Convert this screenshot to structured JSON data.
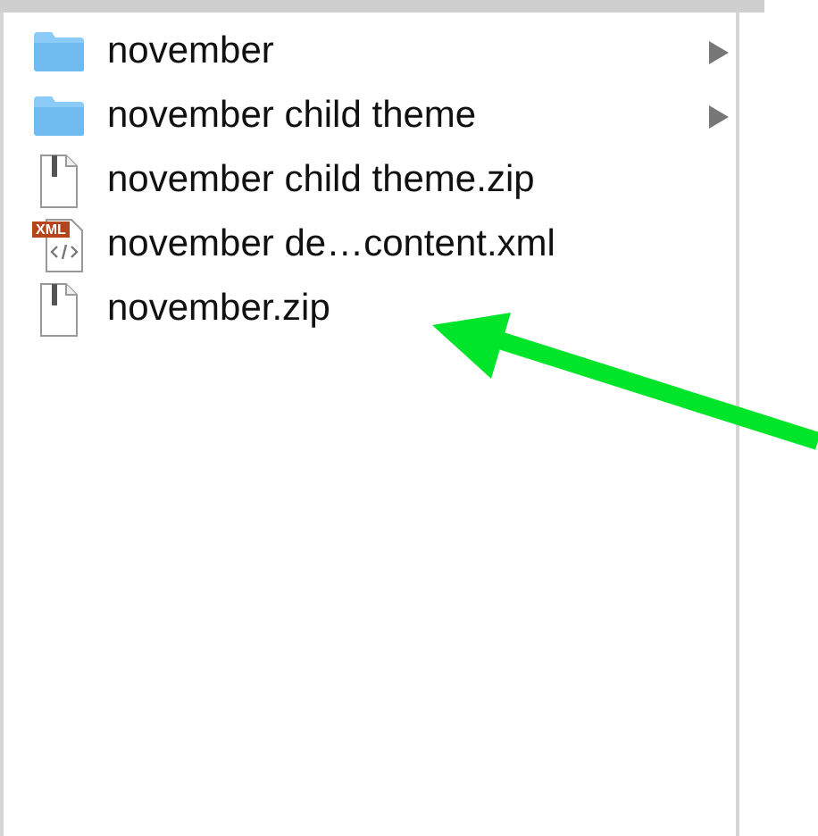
{
  "items": [
    {
      "name": "november",
      "kind": "folder",
      "expandable": true
    },
    {
      "name": "november child theme",
      "kind": "folder",
      "expandable": true
    },
    {
      "name": "november child theme.zip",
      "kind": "zip",
      "expandable": false
    },
    {
      "name": "november de…content.xml",
      "kind": "xml",
      "expandable": false
    },
    {
      "name": "november.zip",
      "kind": "zip",
      "expandable": false
    }
  ],
  "xml_badge": "XML"
}
